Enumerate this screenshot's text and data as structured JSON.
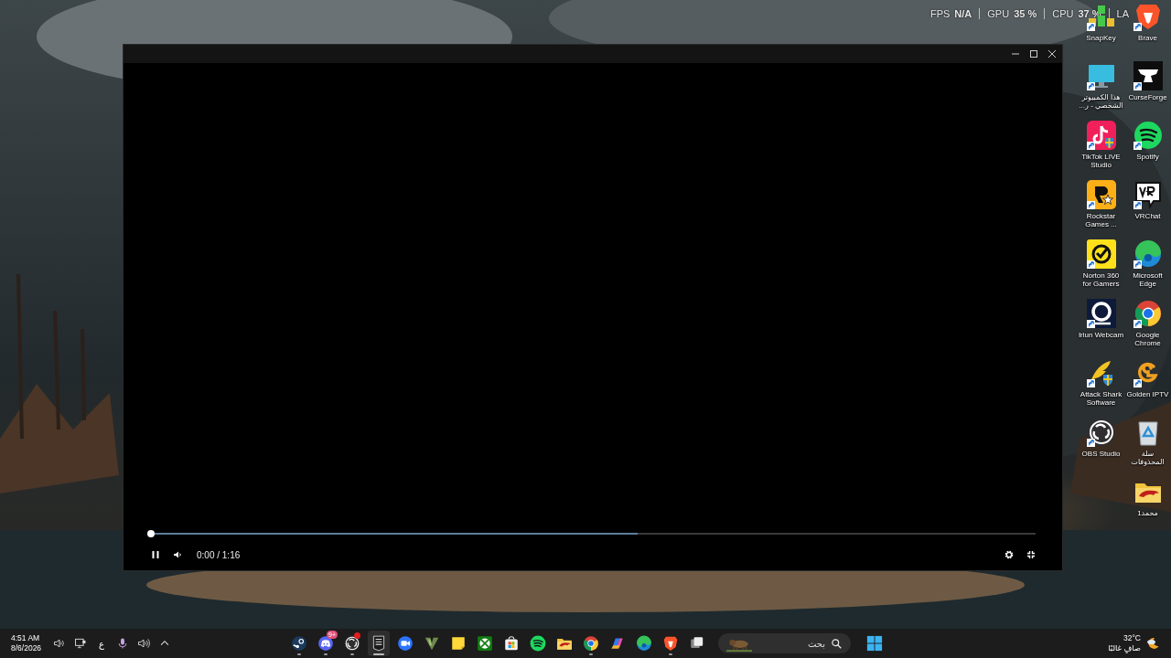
{
  "overlay": {
    "stats": [
      {
        "label": "FPS",
        "value": "N/A"
      },
      {
        "label": "GPU",
        "value": "35 %"
      },
      {
        "label": "CPU",
        "value": "37 %"
      },
      {
        "label": "LA"
      }
    ]
  },
  "video_player": {
    "playing": true,
    "seek_bar": {
      "level": 0
    },
    "buffer_bar": {
      "level": 0.55
    },
    "time": "0:00 / 1:16"
  },
  "desktop_icons": {
    "columns": [
      [
        {
          "kind": "snapkey",
          "label": "SnapKey",
          "shortcut": true
        },
        {
          "kind": "thispc",
          "label": "هذا الكمبيوتر الشخصي - ر...",
          "shortcut": true
        },
        {
          "kind": "tiktok",
          "label": "TikTok LIVE Studio",
          "shortcut": true
        },
        {
          "kind": "rockstar",
          "label": "Rockstar Games ...",
          "shortcut": true
        },
        {
          "kind": "norton",
          "label": "Norton 360 for Gamers",
          "shortcut": true
        },
        {
          "kind": "iriun",
          "label": "Iriun Webcam",
          "shortcut": true
        },
        {
          "kind": "attackshark",
          "label": "Attack Shark Software",
          "shortcut": true
        },
        {
          "kind": "obs",
          "label": "OBS Studio",
          "shortcut": true
        }
      ],
      [
        {
          "kind": "brave",
          "label": "Brave",
          "shortcut": true
        },
        {
          "kind": "curseforge",
          "label": "CurseForge",
          "shortcut": true
        },
        {
          "kind": "spotify",
          "label": "Spotify",
          "shortcut": true
        },
        {
          "kind": "vrchat",
          "label": "VRChat",
          "shortcut": true
        },
        {
          "kind": "edge",
          "label": "Microsoft Edge",
          "shortcut": true
        },
        {
          "kind": "chrome",
          "label": "Google Chrome",
          "shortcut": true
        },
        {
          "kind": "goldeniptv",
          "label": "Golden IPTV",
          "shortcut": true
        },
        {
          "kind": "recycle",
          "label": "سلة المحذوفات",
          "shortcut": false
        },
        {
          "kind": "folder",
          "label": "محمد1",
          "shortcut": false
        }
      ]
    ]
  },
  "taskbar": {
    "clock": {
      "time": "4:51 AM",
      "date": "8/6/2026"
    },
    "tray": [
      {
        "kind": "speaker"
      },
      {
        "kind": "network"
      },
      {
        "kind": "language",
        "text": "ع"
      },
      {
        "kind": "mic"
      },
      {
        "kind": "volume"
      },
      {
        "kind": "chevron"
      }
    ],
    "apps": [
      {
        "kind": "steam",
        "running": true,
        "active": false,
        "dot": false
      },
      {
        "kind": "discord",
        "running": true,
        "active": false,
        "dot": false,
        "badge": "9+"
      },
      {
        "kind": "obs",
        "running": true,
        "active": false,
        "dot": true
      },
      {
        "kind": "epic",
        "running": true,
        "active": true,
        "dot": false
      },
      {
        "kind": "zoom",
        "running": false,
        "active": false,
        "dot": false
      },
      {
        "kind": "vanguard",
        "running": false,
        "active": false,
        "dot": false
      },
      {
        "kind": "sticky",
        "running": false,
        "active": false,
        "dot": false
      },
      {
        "kind": "xbox",
        "running": false,
        "active": false,
        "dot": false
      },
      {
        "kind": "store",
        "running": false,
        "active": false,
        "dot": false
      },
      {
        "kind": "spotify",
        "running": false,
        "active": false,
        "dot": false
      },
      {
        "kind": "folder",
        "running": false,
        "active": false,
        "dot": false
      },
      {
        "kind": "chrome",
        "running": true,
        "active": false,
        "dot": false
      },
      {
        "kind": "copilot",
        "running": false,
        "active": false,
        "dot": false
      },
      {
        "kind": "edge",
        "running": false,
        "active": false,
        "dot": false
      },
      {
        "kind": "brave",
        "running": true,
        "active": false,
        "dot": false
      },
      {
        "kind": "taskview",
        "running": false,
        "active": false,
        "dot": false
      }
    ],
    "search": {
      "placeholder": "بحث"
    },
    "weather": {
      "temperature": "32°C",
      "condition": "صافٍ غالبًا"
    }
  }
}
